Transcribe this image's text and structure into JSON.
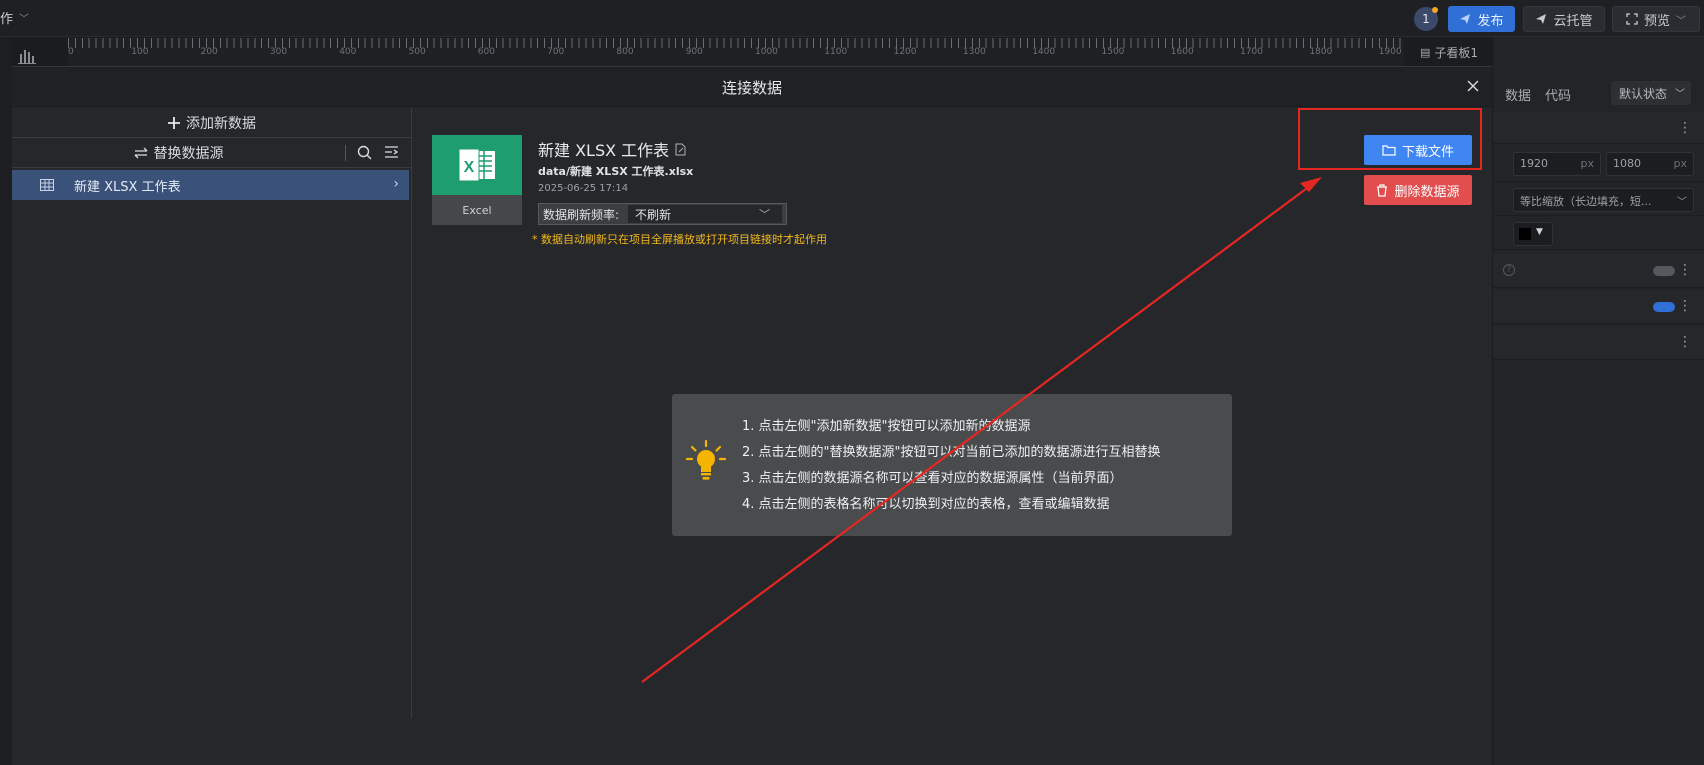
{
  "topbar": {
    "left_menu_label": "作",
    "avatar_count": "1",
    "publish_label": "发布",
    "cloud_label": "云托管",
    "preview_label": "预览"
  },
  "ruler": {
    "labels": [
      "0",
      "100",
      "200",
      "300",
      "400",
      "500",
      "600",
      "700",
      "800",
      "900",
      "1000",
      "1100",
      "1200",
      "1300",
      "1400",
      "1500",
      "1600",
      "1700",
      "1800",
      "1900"
    ]
  },
  "right_panel": {
    "subboard_label": "子看板1",
    "tab_data": "数据",
    "tab_code": "代码",
    "state_select": "默认状态",
    "width_value": "1920",
    "height_value": "1080",
    "unit": "px",
    "scale_mode": "等比缩放（长边填充，短...",
    "colors": {
      "accent": "#2f6fd6",
      "toggle_on": "#2f6fd6"
    }
  },
  "modal": {
    "title": "连接数据",
    "close_label": "×",
    "sidebar": {
      "add_label": "添加新数据",
      "replace_label": "替换数据源",
      "items": [
        {
          "label": "新建 XLSX 工作表"
        }
      ]
    },
    "file": {
      "type_label": "Excel",
      "title": "新建 XLSX 工作表",
      "path": "data/新建 XLSX 工作表.xlsx",
      "date": "2025-06-25 17:14",
      "refresh_label": "数据刷新频率:",
      "refresh_value": "不刷新",
      "note": "* 数据自动刷新只在项目全屏播放或打开项目链接时才起作用"
    },
    "actions": {
      "download_label": "下载文件",
      "delete_label": "删除数据源"
    },
    "tips": [
      "1. 点击左侧\"添加新数据\"按钮可以添加新的数据源",
      "2. 点击左侧的\"替换数据源\"按钮可以对当前已添加的数据源进行互相替换",
      "3. 点击左侧的数据源名称可以查看对应的数据源属性（当前界面）",
      "4. 点击左侧的表格名称可以切换到对应的表格，查看或编辑数据"
    ],
    "colors": {
      "excel_green": "#1e9d6e",
      "download_blue": "#3f86f2",
      "delete_red": "#e24e4e",
      "annotation_red": "#e52722",
      "note_yellow": "#f2b81c"
    }
  }
}
